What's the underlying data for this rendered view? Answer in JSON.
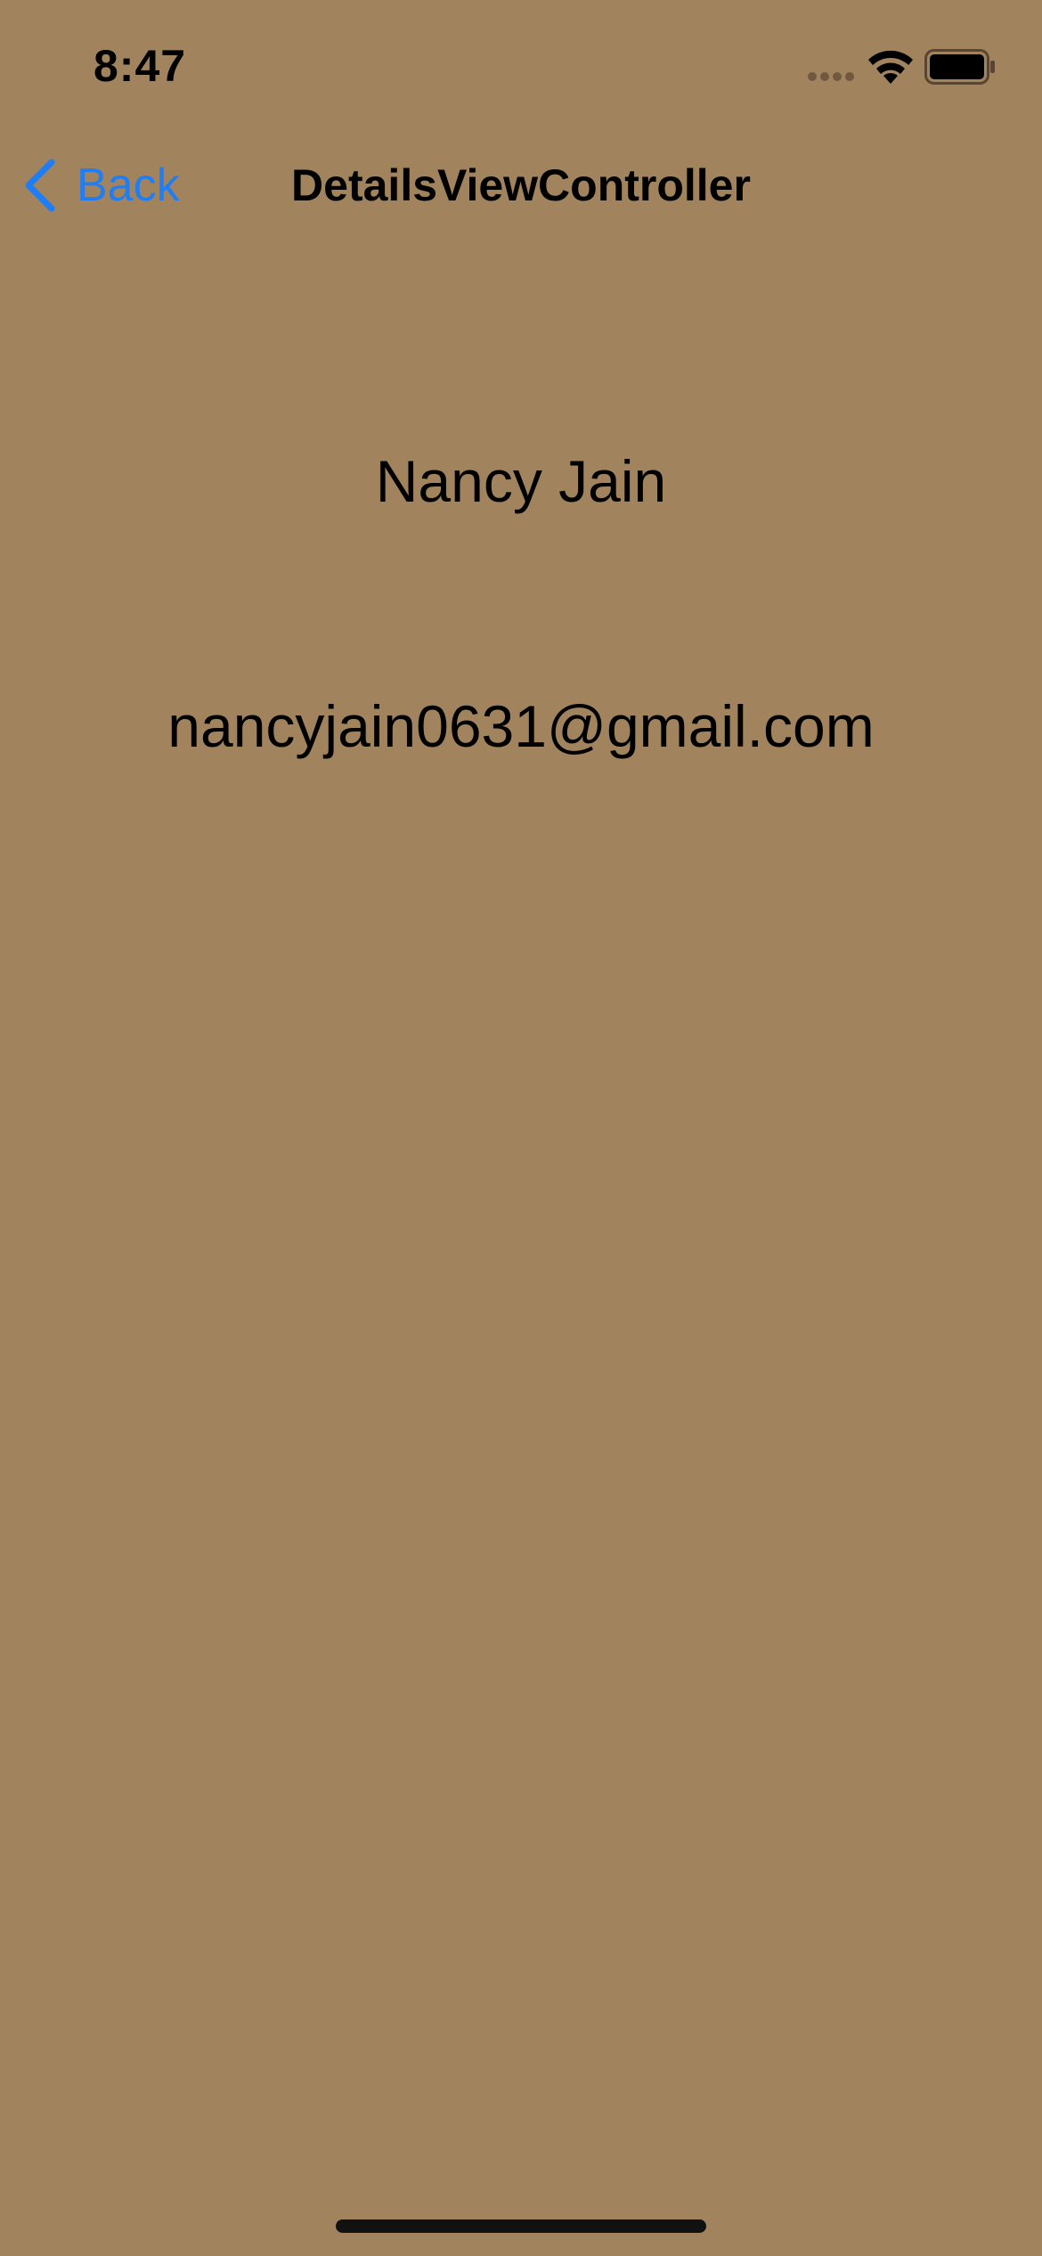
{
  "status_bar": {
    "time": "8:47",
    "icons": [
      "signal-dots-icon",
      "wifi-icon",
      "battery-icon"
    ]
  },
  "nav_bar": {
    "back_label": "Back",
    "title": "DetailsViewController",
    "accent_color": "#1f7df6"
  },
  "details": {
    "name": "Nancy Jain",
    "email": "nancyjain0631@gmail.com"
  },
  "colors": {
    "background": "#a1835e",
    "text": "#000000"
  }
}
